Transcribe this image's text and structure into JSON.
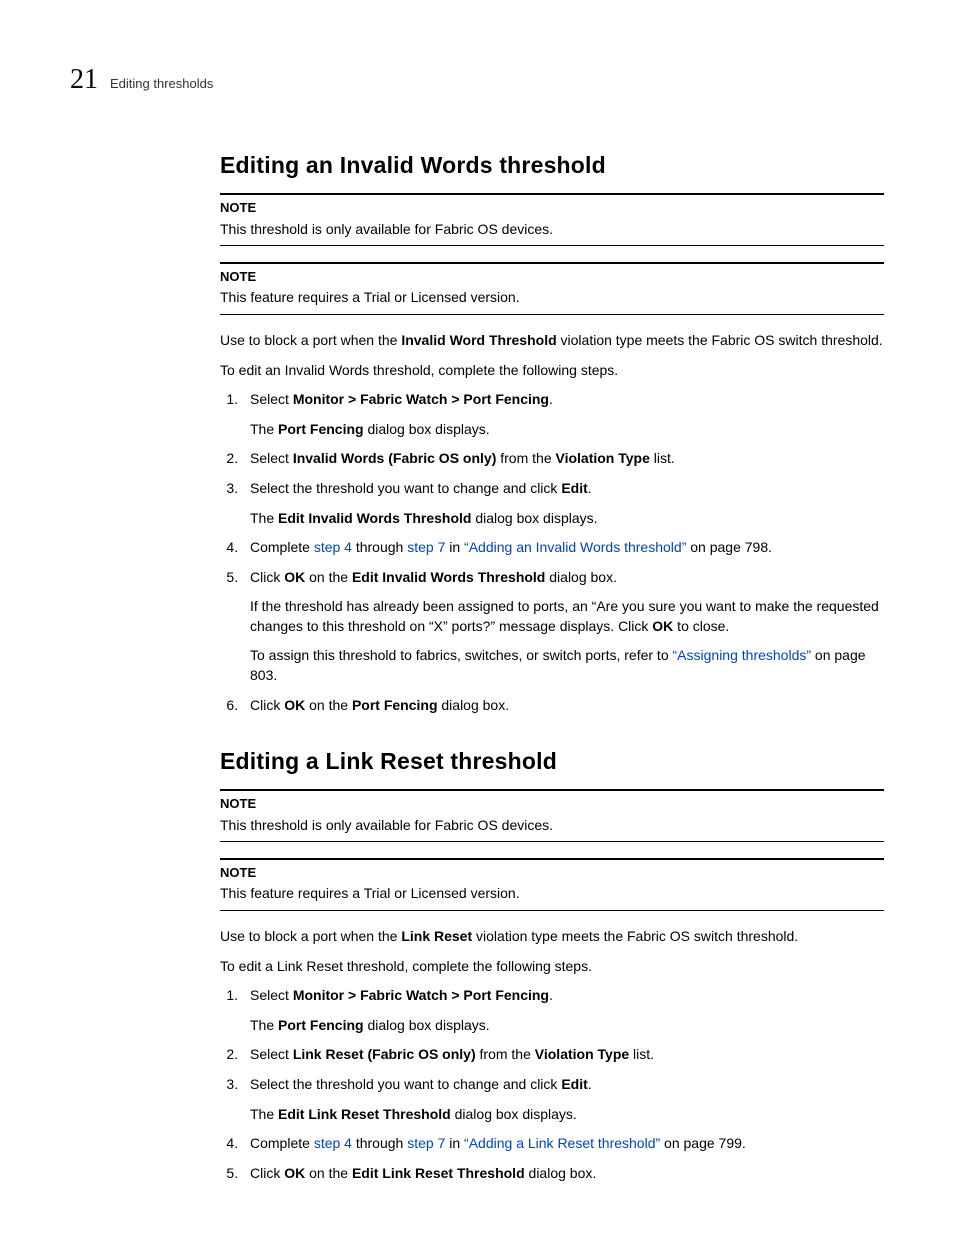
{
  "header": {
    "chapter": "21",
    "running": "Editing thresholds"
  },
  "sec1": {
    "title": "Editing an Invalid Words threshold",
    "note1": {
      "label": "NOTE",
      "text": "This threshold is only available for Fabric OS devices."
    },
    "note2": {
      "label": "NOTE",
      "text": "This feature requires a Trial or Licensed version."
    },
    "intro1a": "Use to block a port when the ",
    "intro1b": "Invalid Word Threshold",
    "intro1c": " violation type meets the Fabric OS switch threshold.",
    "intro2": "To edit an Invalid Words threshold, complete the following steps.",
    "step1a": "Select ",
    "step1b": "Monitor > Fabric Watch > Port Fencing",
    "step1c": ".",
    "step1sub_a": "The ",
    "step1sub_b": "Port Fencing",
    "step1sub_c": " dialog box displays.",
    "step2a": "Select ",
    "step2b": "Invalid Words (Fabric OS only)",
    "step2c": " from the ",
    "step2d": "Violation Type",
    "step2e": " list.",
    "step3a": "Select the threshold you want to change and click ",
    "step3b": "Edit",
    "step3c": ".",
    "step3sub_a": "The ",
    "step3sub_b": "Edit Invalid Words Threshold",
    "step3sub_c": " dialog box displays.",
    "step4a": "Complete ",
    "step4b": "step 4",
    "step4c": " through ",
    "step4d": "step 7",
    "step4e": " in ",
    "step4f": "“Adding an Invalid Words threshold”",
    "step4g": " on page 798.",
    "step5a": "Click ",
    "step5b": "OK",
    "step5c": " on the ",
    "step5d": "Edit Invalid Words Threshold",
    "step5e": " dialog box.",
    "step5sub1a": "If the threshold has already been assigned to ports, an “Are you sure you want to make the requested changes to this threshold on “X” ports?” message displays. Click ",
    "step5sub1b": "OK",
    "step5sub1c": " to close.",
    "step5sub2a": "To assign this threshold to fabrics, switches, or switch ports, refer to ",
    "step5sub2b": "“Assigning thresholds”",
    "step5sub2c": " on page 803.",
    "step6a": "Click ",
    "step6b": "OK",
    "step6c": " on the ",
    "step6d": "Port Fencing",
    "step6e": " dialog box."
  },
  "sec2": {
    "title": "Editing a Link Reset threshold",
    "note1": {
      "label": "NOTE",
      "text": "This threshold is only available for Fabric OS devices."
    },
    "note2": {
      "label": "NOTE",
      "text": "This feature requires a Trial or Licensed version."
    },
    "intro1a": "Use to block a port when the ",
    "intro1b": "Link Reset",
    "intro1c": " violation type meets the Fabric OS switch threshold.",
    "intro2": "To edit a Link Reset threshold, complete the following steps.",
    "step1a": "Select ",
    "step1b": "Monitor > Fabric Watch > Port Fencing",
    "step1c": ".",
    "step1sub_a": "The ",
    "step1sub_b": "Port Fencing",
    "step1sub_c": " dialog box displays.",
    "step2a": "Select ",
    "step2b": "Link Reset (Fabric OS only)",
    "step2c": " from the ",
    "step2d": "Violation Type",
    "step2e": " list.",
    "step3a": "Select the threshold you want to change and click ",
    "step3b": "Edit",
    "step3c": ".",
    "step3sub_a": "The ",
    "step3sub_b": "Edit Link Reset Threshold",
    "step3sub_c": " dialog box displays.",
    "step4a": "Complete ",
    "step4b": "step 4",
    "step4c": " through ",
    "step4d": "step 7",
    "step4e": " in ",
    "step4f": "“Adding a Link Reset threshold”",
    "step4g": " on page 799.",
    "step5a": "Click ",
    "step5b": "OK",
    "step5c": " on the ",
    "step5d": "Edit Link Reset Threshold",
    "step5e": " dialog box."
  }
}
